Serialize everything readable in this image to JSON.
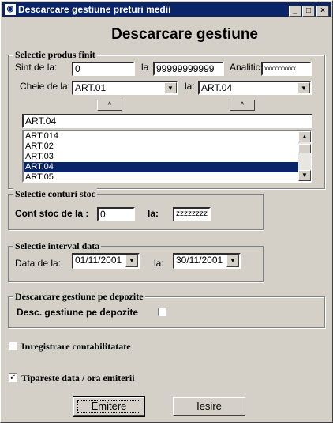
{
  "window": {
    "title": "Descarcare gestiune preturi medii",
    "heading": "Descarcare gestiune",
    "controls": {
      "minimize": "_",
      "maximize": "□",
      "close": "×"
    }
  },
  "produs": {
    "group_title": "Selectie produs finit",
    "sint_label": "Sint   de la:",
    "sint_from": "0",
    "la_label": "la",
    "sint_to": "99999999999",
    "analitic_label": "Analitic",
    "analitic_value": "xxxxxxxxxx",
    "cheie_label": "Cheie de la:",
    "cheie_from": "ART.01",
    "cheie_la_label": "la:",
    "cheie_to": "ART.04",
    "up_symbol": "^",
    "search_value": "ART.04",
    "list_items": [
      "ART.014",
      "ART.02",
      "ART.03",
      "ART.04",
      "ART.05"
    ],
    "selected_index": 3
  },
  "conturi": {
    "group_title": "Selectie conturi stoc",
    "cont_label": "Cont stoc de la :",
    "cont_from": "0",
    "la_label": "la:",
    "cont_to": "zzzzzzzz"
  },
  "interval": {
    "group_title": "Selectie  interval data",
    "data_label": "Data   de la:",
    "date_from": "01/11/2001",
    "la_label": "la:",
    "date_to": "30/11/2001"
  },
  "depozite": {
    "group_title": "Descarcare gestiune pe depozite",
    "check_label": "Desc. gestiune pe depozite",
    "checked": false
  },
  "inregistrare": {
    "label": "Inregistrare contabilitatate",
    "checked": false
  },
  "tipareste": {
    "label": "Tipareste data / ora emiterii",
    "checked": true,
    "mark": "✓"
  },
  "buttons": {
    "emitere": "Emitere",
    "iesire": "Iesire"
  },
  "icons": {
    "dropdown": "▼",
    "scroll_up": "▲",
    "scroll_down": "▼"
  }
}
